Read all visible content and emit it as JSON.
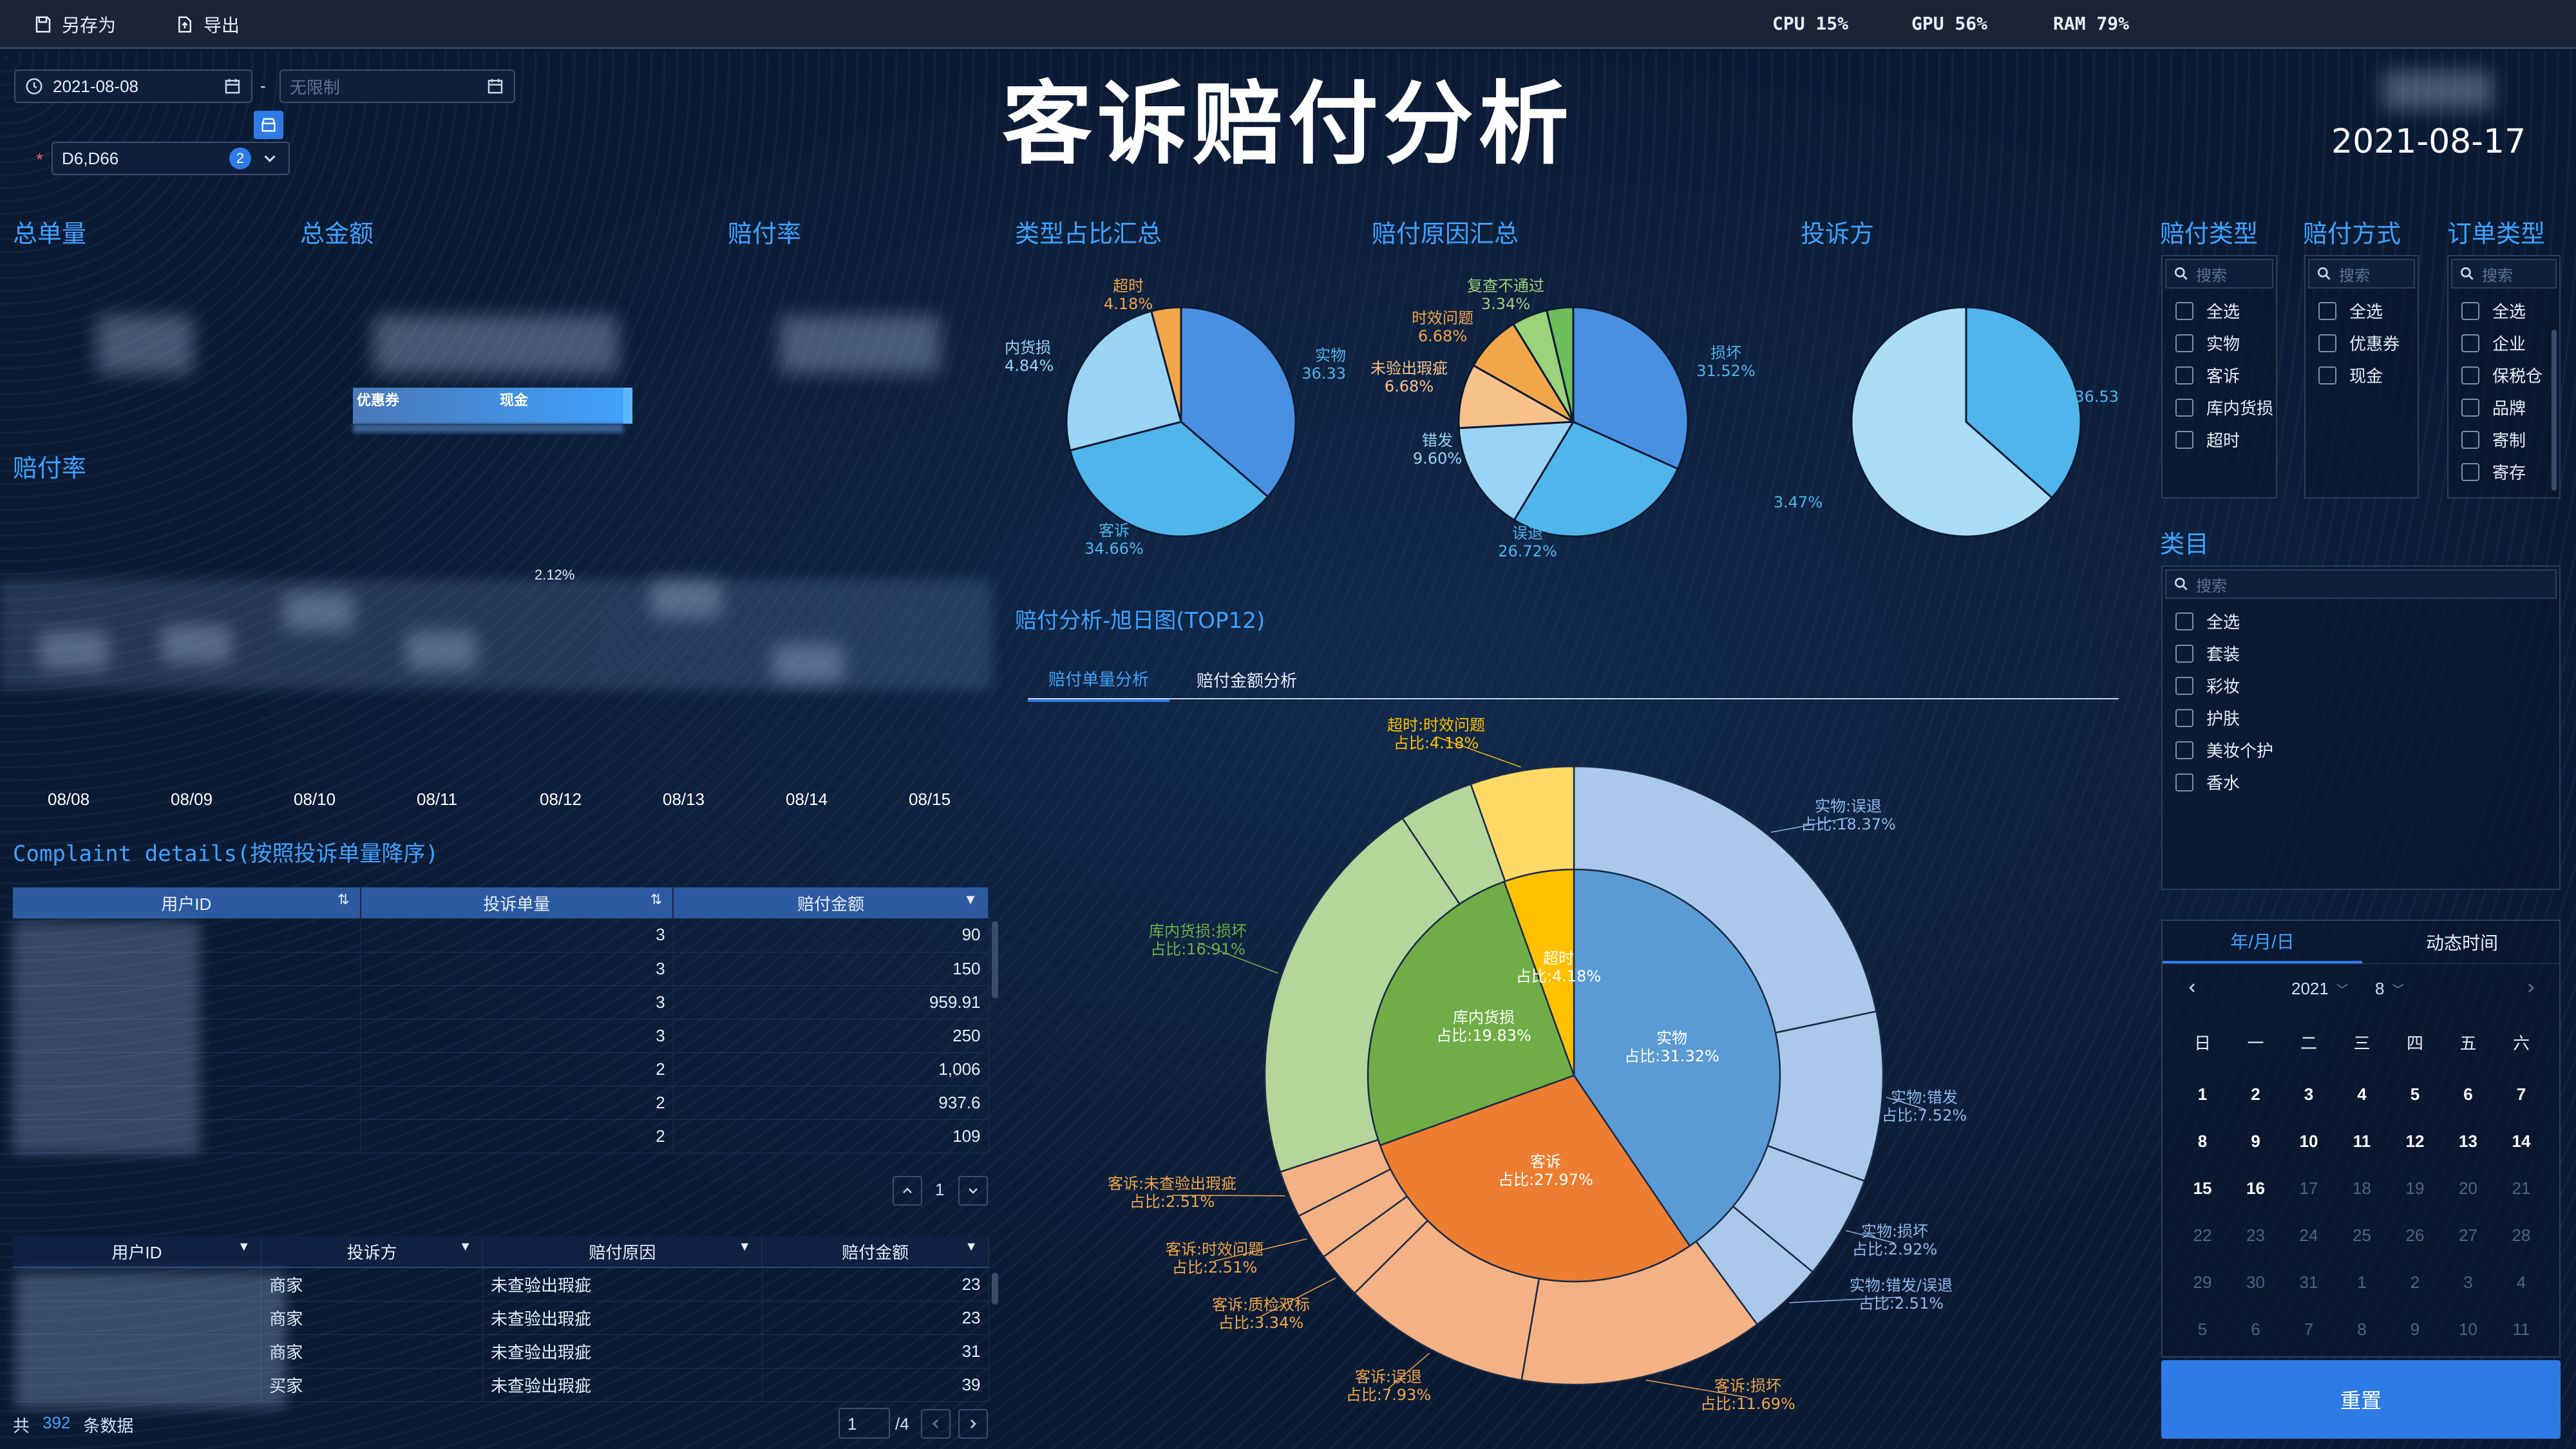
{
  "toolbar": {
    "save_as": "另存为",
    "export": "导出"
  },
  "system": {
    "cpu": "CPU 15%",
    "gpu": "GPU 56%",
    "ram": "RAM 79%"
  },
  "filters": {
    "start_date": "2021-08-08",
    "end_placeholder": "无限制",
    "separator": "-",
    "store_value": "D6,D66",
    "store_count": "2",
    "required_mark": "*"
  },
  "title": "客诉赔付分析",
  "report_date": "2021-08-17",
  "kpi": {
    "total_orders": "总单量",
    "total_amount": "总金额",
    "payout_rate": "赔付率",
    "bar_coupon": "优惠券",
    "bar_cash": "现金"
  },
  "trend": {
    "title": "赔付率",
    "point_label": "2.12%",
    "dates": [
      "08/08",
      "08/09",
      "08/10",
      "08/11",
      "08/12",
      "08/13",
      "08/14",
      "08/15"
    ]
  },
  "pies": {
    "type_summary": {
      "title": "类型占比汇总",
      "slices": [
        {
          "name": "实物",
          "pct": "36.33",
          "value": 36.33,
          "color": "#4a90e2"
        },
        {
          "name": "客诉",
          "pct": "34.66%",
          "value": 34.66,
          "color": "#4fb5ea"
        },
        {
          "name": "内货损",
          "pct": "4.84%",
          "value": 24.83,
          "color": "#9ad4f5"
        },
        {
          "name": "超时",
          "pct": "4.18%",
          "value": 4.18,
          "color": "#f2a64a"
        }
      ]
    },
    "reason_summary": {
      "title": "赔付原因汇总",
      "slices": [
        {
          "name": "损坏",
          "pct": "31.52%",
          "value": 31.52,
          "color": "#4a90e2"
        },
        {
          "name": "误退",
          "pct": "26.72%",
          "value": 26.72,
          "color": "#4fb5ea"
        },
        {
          "name": "错发",
          "pct": "9.60%",
          "value": 15.4,
          "color": "#9ad4f5"
        },
        {
          "name": "未验出瑕疵",
          "pct": "6.68%",
          "value": 9.0,
          "color": "#f7c28a"
        },
        {
          "name": "时效问题",
          "pct": "6.68%",
          "value": 8.0,
          "color": "#f2a64a"
        },
        {
          "name": "复查不通过",
          "pct": "3.34%",
          "value": 5.0,
          "color": "#9bd27a"
        },
        {
          "name": "",
          "pct": "",
          "value": 3.7,
          "color": "#6cbf5a"
        }
      ]
    },
    "complainant": {
      "title": "投诉方",
      "slices": [
        {
          "name": "",
          "pct": "36.53",
          "value": 36.53,
          "color": "#4fb5ea"
        },
        {
          "name": "",
          "pct": "3.47%",
          "value": 63.47,
          "color": "#a9dcf5"
        }
      ]
    }
  },
  "sunburst": {
    "title": "赔付分析-旭日图(TOP12)",
    "tabs": [
      "赔付单量分析",
      "赔付金额分析"
    ],
    "inner": [
      {
        "name": "实物",
        "pct": "占比:31.32%",
        "value": 40.5,
        "color": "#5b9bd5"
      },
      {
        "name": "客诉",
        "pct": "占比:27.97%",
        "value": 29.0,
        "color": "#ed7d31"
      },
      {
        "name": "库内货损",
        "pct": "占比:19.83%",
        "value": 25.0,
        "color": "#70ad47"
      },
      {
        "name": "超时",
        "pct": "占比:4.18%",
        "value": 5.5,
        "color": "#ffc000"
      }
    ],
    "outer": [
      {
        "name": "实物:误退",
        "pct": "占比:18.37%",
        "value": 22.0,
        "color": "#a9c8ea"
      },
      {
        "name": "实物:错发",
        "pct": "占比:7.52%",
        "value": 9.0,
        "color": "#a9c8ea"
      },
      {
        "name": "实物:损坏",
        "pct": "占比:2.92%",
        "value": 5.5,
        "color": "#a9c8ea"
      },
      {
        "name": "实物:错发/误退",
        "pct": "占比:2.51%",
        "value": 4.0,
        "color": "#a9c8ea"
      },
      {
        "name": "客诉:损坏",
        "pct": "占比:11.69%",
        "value": 13.0,
        "color": "#f4b183"
      },
      {
        "name": "客诉:误退",
        "pct": "占比:7.93%",
        "value": 10.0,
        "color": "#f4b183"
      },
      {
        "name": "客诉:质检双标",
        "pct": "占比:3.34%",
        "value": 2.5,
        "color": "#f4b183"
      },
      {
        "name": "客诉:时效问题",
        "pct": "占比:2.51%",
        "value": 2.5,
        "color": "#f4b183"
      },
      {
        "name": "客诉:未查验出瑕疵",
        "pct": "占比:2.51%",
        "value": 2.5,
        "color": "#f4b183"
      },
      {
        "name": "库内货损:损坏",
        "pct": "占比:16.91%",
        "value": 21.0,
        "color": "#b5d69a"
      },
      {
        "name": "",
        "pct": "",
        "value": 4.0,
        "color": "#b5d69a"
      },
      {
        "name": "超时:时效问题",
        "pct": "占比:4.18%",
        "value": 5.5,
        "color": "#ffd966"
      }
    ]
  },
  "complaint_details": {
    "title": "Complaint details(按照投诉单量降序)",
    "columns": [
      "用户ID",
      "投诉单量",
      "赔付金额"
    ],
    "rows": [
      {
        "count": "3",
        "amount": "90"
      },
      {
        "count": "3",
        "amount": "150"
      },
      {
        "count": "3",
        "amount": "959.91"
      },
      {
        "count": "3",
        "amount": "250"
      },
      {
        "count": "2",
        "amount": "1,006"
      },
      {
        "count": "2",
        "amount": "937.6"
      },
      {
        "count": "2",
        "amount": "109"
      }
    ],
    "page": "1"
  },
  "detail2": {
    "columns": [
      "用户ID",
      "投诉方",
      "赔付原因",
      "赔付金额"
    ],
    "rows": [
      {
        "party": "商家",
        "reason": "未查验出瑕疵",
        "amount": "23"
      },
      {
        "party": "商家",
        "reason": "未查验出瑕疵",
        "amount": "23"
      },
      {
        "party": "商家",
        "reason": "未查验出瑕疵",
        "amount": "31"
      },
      {
        "party": "买家",
        "reason": "未查验出瑕疵",
        "amount": "39"
      }
    ],
    "total_prefix": "共",
    "total_count": "392",
    "total_suffix": "条数据",
    "page": "1",
    "pages": "/4"
  },
  "filter_panels": {
    "payout_type": {
      "title": "赔付类型",
      "search": "搜索",
      "items": [
        "全选",
        "实物",
        "客诉",
        "库内货损",
        "超时"
      ]
    },
    "payout_method": {
      "title": "赔付方式",
      "search": "搜索",
      "items": [
        "全选",
        "优惠券",
        "现金"
      ]
    },
    "order_type": {
      "title": "订单类型",
      "search": "搜索",
      "items": [
        "全选",
        "企业",
        "保税仓",
        "品牌",
        "寄制",
        "寄存"
      ]
    },
    "category": {
      "title": "类目",
      "search": "搜索",
      "items": [
        "全选",
        "套装",
        "彩妆",
        "护肤",
        "美妆个护",
        "香水"
      ]
    }
  },
  "calendar": {
    "tabs": [
      "年/月/日",
      "动态时间"
    ],
    "year": "2021",
    "month": "8",
    "weekdays": [
      "日",
      "一",
      "二",
      "三",
      "四",
      "五",
      "六"
    ],
    "weeks": [
      [
        "1",
        "2",
        "3",
        "4",
        "5",
        "6",
        "7"
      ],
      [
        "8",
        "9",
        "10",
        "11",
        "12",
        "13",
        "14"
      ],
      [
        "15",
        "16",
        "17",
        "18",
        "19",
        "20",
        "21"
      ],
      [
        "22",
        "23",
        "24",
        "25",
        "26",
        "27",
        "28"
      ],
      [
        "29",
        "30",
        "31",
        "1",
        "2",
        "3",
        "4"
      ],
      [
        "5",
        "6",
        "7",
        "8",
        "9",
        "10",
        "11"
      ]
    ]
  },
  "reset_label": "重置"
}
